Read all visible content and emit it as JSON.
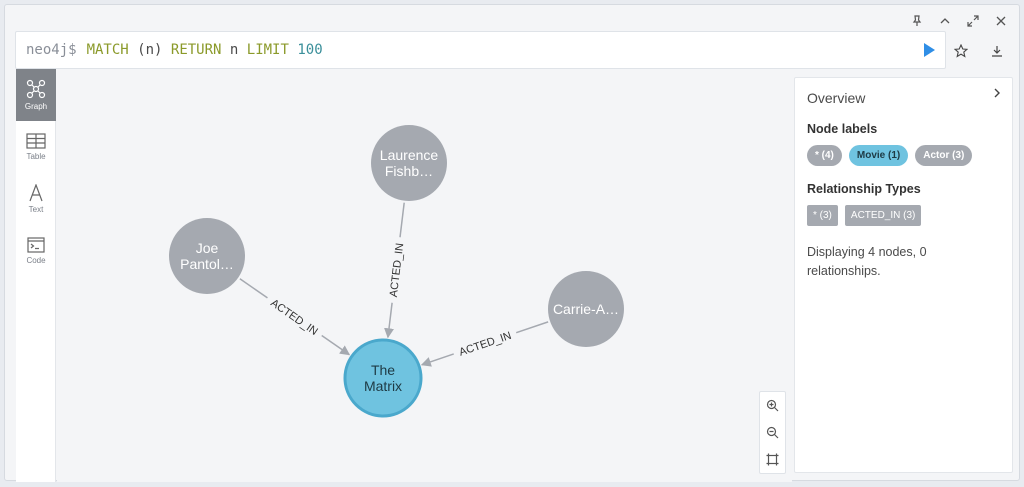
{
  "editor": {
    "prompt": "neo4j$",
    "query": [
      {
        "t": "MATCH",
        "c": "kw"
      },
      {
        "t": " (n) ",
        "c": "ident"
      },
      {
        "t": "RETURN",
        "c": "kw"
      },
      {
        "t": " n ",
        "c": "ident"
      },
      {
        "t": "LIMIT",
        "c": "kw"
      },
      {
        "t": " ",
        "c": "ident"
      },
      {
        "t": "100",
        "c": "num"
      }
    ]
  },
  "window_controls": [
    "pin-icon",
    "collapse-icon",
    "expand-icon",
    "close-icon"
  ],
  "nav": {
    "items": [
      {
        "label": "Graph",
        "icon": "graph-icon",
        "active": true
      },
      {
        "label": "Table",
        "icon": "table-icon",
        "active": false
      },
      {
        "label": "Text",
        "icon": "text-icon",
        "active": false
      },
      {
        "label": "Code",
        "icon": "code-icon",
        "active": false
      }
    ]
  },
  "graph": {
    "nodes": [
      {
        "id": "laurence",
        "line1": "Laurence",
        "line2": "Fishb…",
        "label": "Actor"
      },
      {
        "id": "joe",
        "line1": "Joe",
        "line2": "Pantol…",
        "label": "Actor"
      },
      {
        "id": "carrie",
        "line1": "Carrie-A…",
        "line2": "",
        "label": "Actor"
      },
      {
        "id": "matrix",
        "line1": "The",
        "line2": "Matrix",
        "label": "Movie"
      }
    ],
    "relationships": [
      {
        "from": "laurence",
        "to": "matrix",
        "type": "ACTED_IN"
      },
      {
        "from": "joe",
        "to": "matrix",
        "type": "ACTED_IN"
      },
      {
        "from": "carrie",
        "to": "matrix",
        "type": "ACTED_IN"
      }
    ],
    "colors": {
      "Actor": "#a5a9b0",
      "Movie": "#6fc3e0",
      "movie_border": "#4aa8cc",
      "rel": "#a5a9b0"
    }
  },
  "zoom": [
    "zoom-in-icon",
    "zoom-out-icon",
    "fit-icon"
  ],
  "overview": {
    "title": "Overview",
    "node_labels_heading": "Node labels",
    "node_labels": [
      {
        "text": "* (4)",
        "kind": "all"
      },
      {
        "text": "Movie (1)",
        "kind": "movie"
      },
      {
        "text": "Actor (3)",
        "kind": "actor"
      }
    ],
    "rel_types_heading": "Relationship Types",
    "rel_types": [
      "* (3)",
      "ACTED_IN (3)"
    ],
    "summary": "Displaying 4 nodes, 0 relationships."
  }
}
